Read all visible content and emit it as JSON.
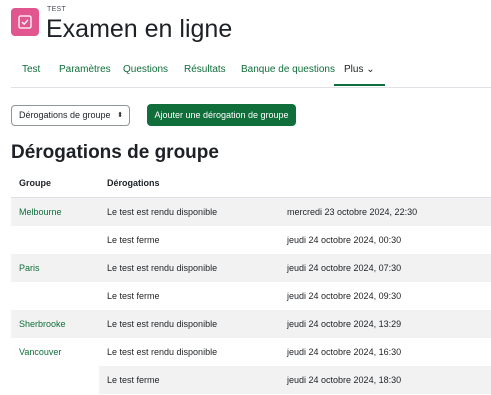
{
  "header": {
    "overline": "TEST",
    "title": "Examen en ligne",
    "icon": "quiz-check-icon",
    "icon_color": "#e2568f"
  },
  "nav": {
    "items": [
      {
        "label": "Test"
      },
      {
        "label": "Paramètres"
      },
      {
        "label": "Questions"
      },
      {
        "label": "Résultats"
      },
      {
        "label": "Banque de questions"
      },
      {
        "label": "Plus ⌄"
      }
    ]
  },
  "controls": {
    "select_value": "Dérogations de groupe",
    "select_caret": "⬍",
    "add_button": "Ajouter une dérogation de groupe"
  },
  "section": {
    "title": "Dérogations de groupe"
  },
  "table": {
    "headers": {
      "group": "Groupe",
      "overrides": "Dérogations"
    },
    "rows": [
      {
        "group": "Melbourne",
        "type": "Le test est rendu disponible",
        "date": "mercredi 23 octobre 2024, 22:30"
      },
      {
        "group": "",
        "type": "Le test ferme",
        "date": "jeudi 24 octobre 2024, 00:30"
      },
      {
        "group": "Paris",
        "type": "Le test est rendu disponible",
        "date": "jeudi 24 octobre 2024, 07:30"
      },
      {
        "group": "",
        "type": "Le test ferme",
        "date": "jeudi 24 octobre 2024, 09:30"
      },
      {
        "group": "Sherbrooke",
        "type": "Le test est rendu disponible",
        "date": "jeudi 24 octobre 2024, 13:29"
      },
      {
        "group": "Vancouver",
        "type": "Le test est rendu disponible",
        "date": "jeudi 24 octobre 2024, 16:30"
      },
      {
        "group": "",
        "type": "Le test ferme",
        "date": "jeudi 24 octobre 2024, 18:30"
      }
    ]
  },
  "colors": {
    "accent": "#0f6e3a",
    "stripe": "#f2f2f2"
  }
}
